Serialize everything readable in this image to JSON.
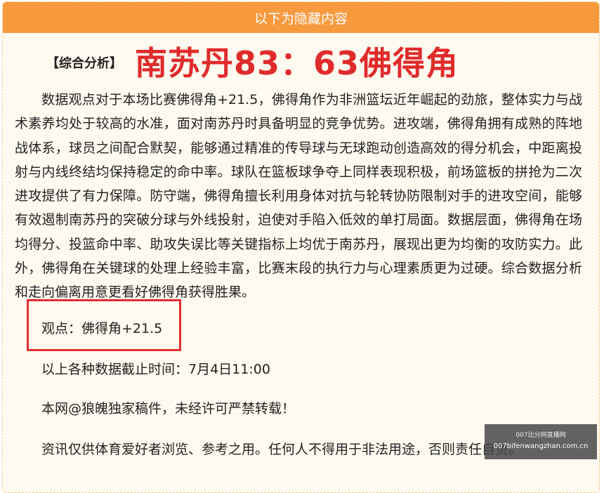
{
  "top_bar": {
    "label": "以下为隐藏内容"
  },
  "headline": {
    "label": "【综合分析】",
    "title": "南苏丹83：63佛得角"
  },
  "analysis": {
    "paragraph": "数据观点对于本场比赛佛得角+21.5，佛得角作为非洲篮坛近年崛起的劲旅，整体实力与战术素养均处于较高的水准，面对南苏丹时具备明显的竞争优势。进攻端，佛得角拥有成熟的阵地战体系，球员之间配合默契，能够通过精准的传导球与无球跑动创造高效的得分机会，中距离投射与内线终结均保持稳定的命中率。球队在篮板球争夺上同样表现积极，前场篮板的拼抢为二次进攻提供了有力保障。防守端，佛得角擅长利用身体对抗与轮转协防限制对手的进攻空间，能够有效遏制南苏丹的突破分球与外线投射，迫使对手陷入低效的单打局面。数据层面，佛得角在场均得分、投篮命中率、助攻失误比等关键指标上均优于南苏丹，展现出更为均衡的攻防实力。此外，佛得角在关键球的处理上经验丰富，比赛末段的执行力与心理素质更为过硬。综合数据分析和走向偏离用意更看好佛得角获得胜果。"
  },
  "viewpoint": {
    "text": "观点：佛得角+21.5"
  },
  "footer": {
    "deadline": "以上各种数据截止时间：7月4日11:00",
    "copyright": "本网@狼魄独家稿件，未经许可严禁转载！",
    "disclaimer": "资讯仅供体育爱好者浏览、参考之用。任何人不得用于非法用途，否则责任自负。"
  },
  "watermark": {
    "line1": "007比分网直播网",
    "line2": "007bifenwangzhan.com.cn"
  },
  "colors": {
    "top_bar": "#f79a3e",
    "title_red": "#e02b2b",
    "box_red": "#e03030",
    "background": "#fffaf0"
  }
}
